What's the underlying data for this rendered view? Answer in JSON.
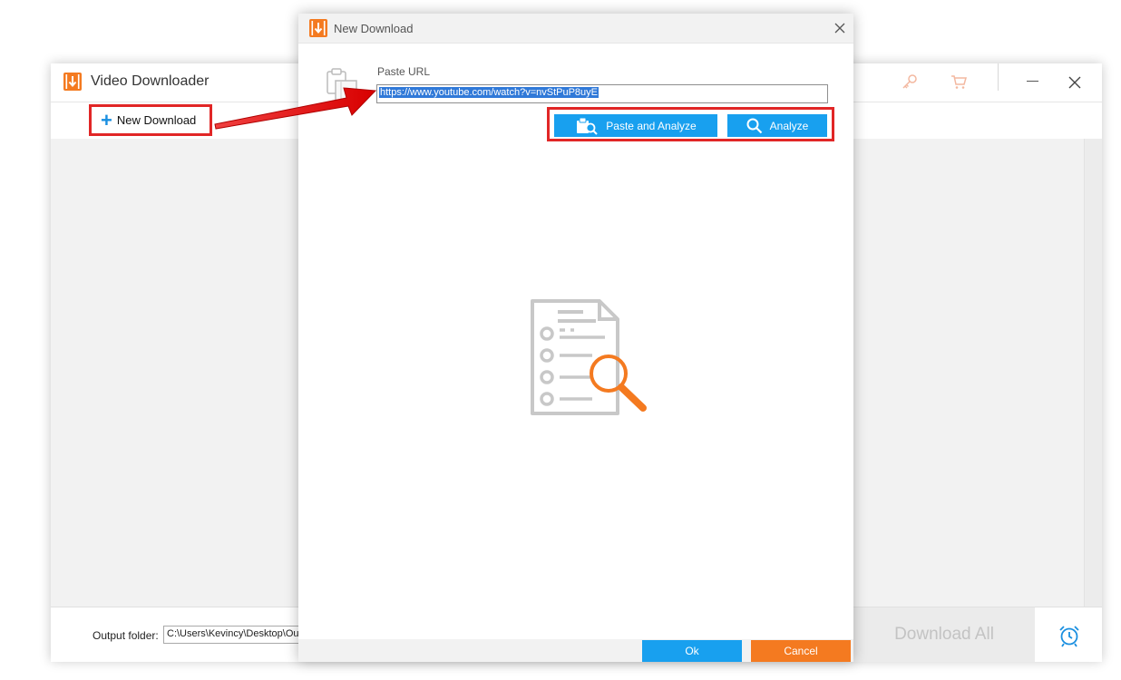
{
  "main_window": {
    "title": "Video Downloader",
    "toolbar": {
      "new_download_label": "New Download",
      "new_download_icon": "plus-icon"
    },
    "titlebar_icons": [
      "key-icon",
      "cart-icon",
      "minimize-icon",
      "close-icon"
    ],
    "bottom": {
      "output_label": "Output folder:",
      "output_path": "C:\\Users\\Kevincy\\Desktop\\Out",
      "download_all_label": "Download All",
      "alarm_icon": "alarm-clock-icon"
    }
  },
  "dialog": {
    "title": "New Download",
    "paste_url_label": "Paste URL",
    "url_value": "https://www.youtube.com/watch?v=nvStPuP8uyE",
    "paste_analyze_label": "Paste and Analyze",
    "analyze_label": "Analyze",
    "ok_label": "Ok",
    "cancel_label": "Cancel"
  },
  "colors": {
    "accent_blue": "#18a0ef",
    "accent_orange": "#f47a20",
    "highlight_red": "#e12626",
    "selection_blue": "#3079d8"
  }
}
